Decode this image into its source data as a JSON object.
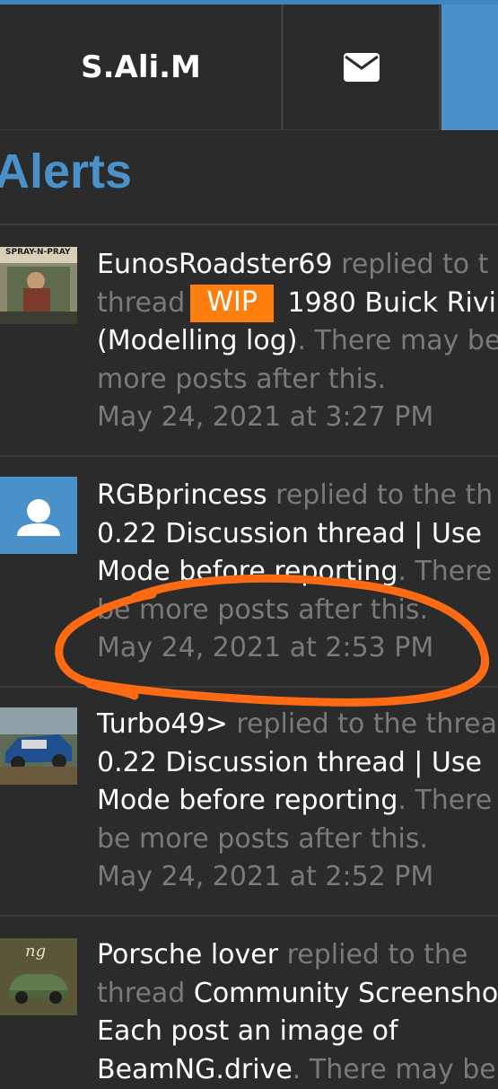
{
  "tabs": {
    "user_label": "S.Ali.M",
    "mail_icon": "envelope-icon",
    "alerts_tab_color": "#4a90c9"
  },
  "page": {
    "title": "Alerts"
  },
  "alerts": [
    {
      "user": "EunosRoadster69",
      "line1_tail": " replied to t",
      "line2_prefix": "thread",
      "prefix_badge": "WIP",
      "line2_link": " 1980 Buick Rivi",
      "line3_link": "(Modelling log)",
      "line3_tail": ". There may be",
      "line4": "more posts after this.",
      "time": "May 24, 2021 at 3:27 PM",
      "avatar_caption": "SPRAY-N-PRAY"
    },
    {
      "user": "RGBprincess",
      "line1_tail": " replied to the th",
      "line2_link": "0.22 Discussion thread | Use",
      "line3_link": "Mode before reporting",
      "line3_tail": ". There",
      "line4": "be more posts after this.",
      "time": "May 24, 2021 at 2:53 PM"
    },
    {
      "user": "Turbo49>",
      "line1_tail": " replied to the threa",
      "line2_link": "0.22 Discussion thread | Use",
      "line3_link": "Mode before reporting",
      "line3_tail": ". There",
      "line4": "be more posts after this.",
      "time": "May 24, 2021 at 2:52 PM"
    },
    {
      "user": "Porsche lover",
      "line1_tail": " replied to the",
      "line2_prefix": "thread",
      "line2_link": " Community Screensho",
      "line3_link": "Each post an image of",
      "line4_link": "BeamNG.drive",
      "line4_tail": ". There may be",
      "avatar_caption": "ng"
    }
  ],
  "colors": {
    "background": "#2b2b2b",
    "accent": "#4a90c9",
    "badge": "#ff7f0e",
    "annotation": "#ff6a13"
  }
}
